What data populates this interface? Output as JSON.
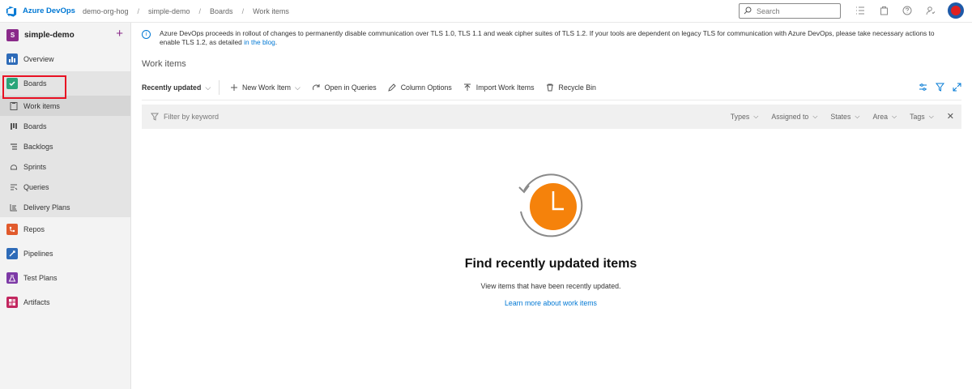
{
  "topbar": {
    "brand": "Azure DevOps",
    "org": "demo-org-hog",
    "crumbs": [
      "simple-demo",
      "Boards",
      "Work items"
    ],
    "search_placeholder": "Search"
  },
  "sidebar": {
    "project_initial": "S",
    "project_name": "simple-demo",
    "items": [
      {
        "label": "Overview",
        "icon": "overview-icon",
        "color": "#2e6bb8"
      },
      {
        "label": "Boards",
        "icon": "boards-icon",
        "color": "#2aa57a"
      },
      {
        "label": "Repos",
        "icon": "repos-icon",
        "color": "#e15a2c"
      },
      {
        "label": "Pipelines",
        "icon": "pipelines-icon",
        "color": "#2e6bb8"
      },
      {
        "label": "Test Plans",
        "icon": "test-plans-icon",
        "color": "#7d3aa6"
      },
      {
        "label": "Artifacts",
        "icon": "artifacts-icon",
        "color": "#c2275f"
      }
    ],
    "sub_items": [
      {
        "label": "Work items",
        "icon": "work-items-icon"
      },
      {
        "label": "Boards",
        "icon": "board-columns-icon"
      },
      {
        "label": "Backlogs",
        "icon": "backlogs-icon"
      },
      {
        "label": "Sprints",
        "icon": "sprints-icon"
      },
      {
        "label": "Queries",
        "icon": "queries-icon"
      },
      {
        "label": "Delivery Plans",
        "icon": "delivery-plans-icon"
      }
    ]
  },
  "banner": {
    "text": "Azure DevOps proceeds in rollout of changes to permanently disable communication over TLS 1.0, TLS 1.1 and weak cipher suites of TLS 1.2. If your tools are dependent on legacy TLS for communication with Azure DevOps, please take necessary actions to enable TLS 1.2, as detailed",
    "link": "in the blog",
    "end": "."
  },
  "main": {
    "title": "Work items",
    "toolbar": {
      "view": "Recently updated",
      "new_item": "New Work Item",
      "open_queries": "Open in Queries",
      "column_options": "Column Options",
      "import": "Import Work Items",
      "recycle": "Recycle Bin"
    },
    "filter": {
      "placeholder": "Filter by keyword",
      "dropdowns": [
        "Types",
        "Assigned to",
        "States",
        "Area",
        "Tags"
      ]
    },
    "empty": {
      "title": "Find recently updated items",
      "subtitle": "View items that have been recently updated.",
      "link": "Learn more about work items"
    }
  },
  "colors": {
    "accent": "#0078d4",
    "highlight": "#e81123",
    "clock": "#f5820b"
  }
}
